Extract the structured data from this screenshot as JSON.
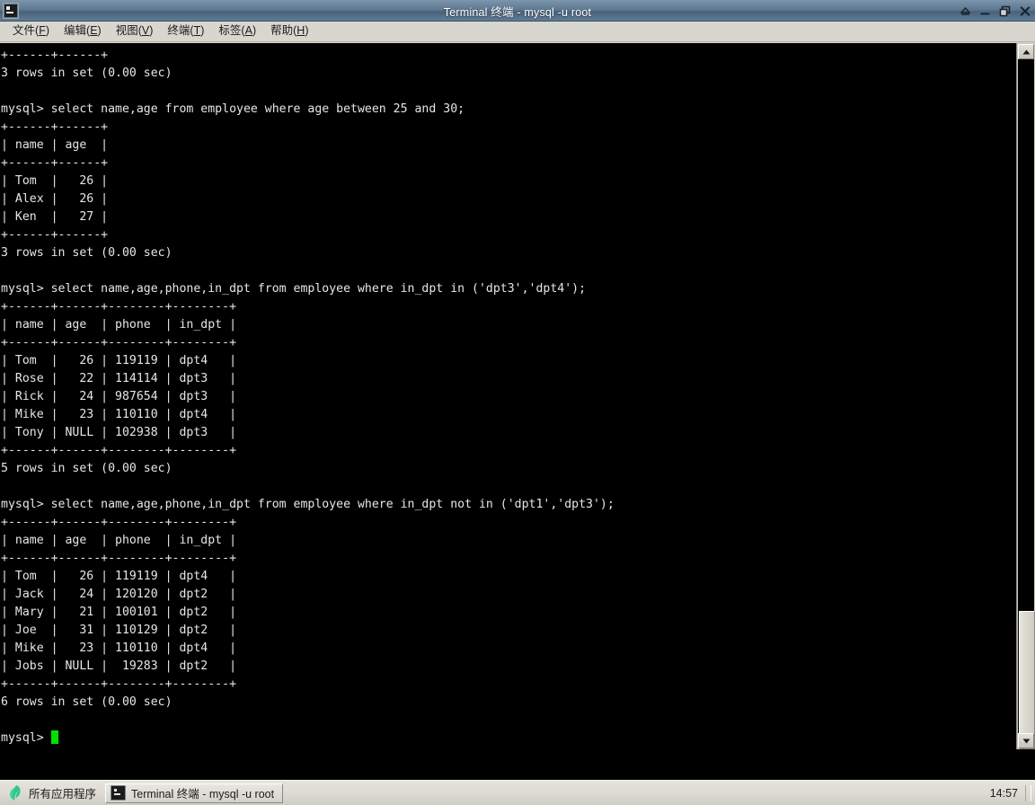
{
  "window": {
    "title": "Terminal 终端 - mysql -u root",
    "icon": "terminal-icon",
    "buttons": {
      "shade": "shade-window-button",
      "minimize": "minimize-window-button",
      "maximize": "maximize-window-button",
      "close": "close-window-button"
    }
  },
  "menubar": {
    "items": [
      {
        "label": "文件",
        "mnemonic": "F",
        "name": "menu-file"
      },
      {
        "label": "编辑",
        "mnemonic": "E",
        "name": "menu-edit"
      },
      {
        "label": "视图",
        "mnemonic": "V",
        "name": "menu-view"
      },
      {
        "label": "终端",
        "mnemonic": "T",
        "name": "menu-terminal"
      },
      {
        "label": "标签",
        "mnemonic": "A",
        "name": "menu-tabs"
      },
      {
        "label": "帮助",
        "mnemonic": "H",
        "name": "menu-help"
      }
    ]
  },
  "terminal": {
    "prompt": "mysql> ",
    "foreground_color": "#e6e6e6",
    "background_color": "#000000",
    "cursor_color": "#00e000",
    "lines": [
      "+------+------+",
      "3 rows in set (0.00 sec)",
      "",
      "mysql> select name,age from employee where age between 25 and 30;",
      "+------+------+",
      "| name | age  |",
      "+------+------+",
      "| Tom  |   26 |",
      "| Alex |   26 |",
      "| Ken  |   27 |",
      "+------+------+",
      "3 rows in set (0.00 sec)",
      "",
      "mysql> select name,age,phone,in_dpt from employee where in_dpt in ('dpt3','dpt4');",
      "+------+------+--------+--------+",
      "| name | age  | phone  | in_dpt |",
      "+------+------+--------+--------+",
      "| Tom  |   26 | 119119 | dpt4   |",
      "| Rose |   22 | 114114 | dpt3   |",
      "| Rick |   24 | 987654 | dpt3   |",
      "| Mike |   23 | 110110 | dpt4   |",
      "| Tony | NULL | 102938 | dpt3   |",
      "+------+------+--------+--------+",
      "5 rows in set (0.00 sec)",
      "",
      "mysql> select name,age,phone,in_dpt from employee where in_dpt not in ('dpt1','dpt3');",
      "+------+------+--------+--------+",
      "| name | age  | phone  | in_dpt |",
      "+------+------+--------+--------+",
      "| Tom  |   26 | 119119 | dpt4   |",
      "| Jack |   24 | 120120 | dpt2   |",
      "| Mary |   21 | 100101 | dpt2   |",
      "| Joe  |   31 | 110129 | dpt2   |",
      "| Mike |   23 | 110110 | dpt4   |",
      "| Jobs | NULL |  19283 | dpt2   |",
      "+------+------+--------+--------+",
      "6 rows in set (0.00 sec)",
      ""
    ],
    "queries": [
      {
        "sql": "select name,age from employee where age between 25 and 30;",
        "columns": [
          "name",
          "age"
        ],
        "rows": [
          [
            "Tom",
            "26"
          ],
          [
            "Alex",
            "26"
          ],
          [
            "Ken",
            "27"
          ]
        ],
        "result_status": "3 rows in set (0.00 sec)"
      },
      {
        "sql": "select name,age,phone,in_dpt from employee where in_dpt in ('dpt3','dpt4');",
        "columns": [
          "name",
          "age",
          "phone",
          "in_dpt"
        ],
        "rows": [
          [
            "Tom",
            "26",
            "119119",
            "dpt4"
          ],
          [
            "Rose",
            "22",
            "114114",
            "dpt3"
          ],
          [
            "Rick",
            "24",
            "987654",
            "dpt3"
          ],
          [
            "Mike",
            "23",
            "110110",
            "dpt4"
          ],
          [
            "Tony",
            "NULL",
            "102938",
            "dpt3"
          ]
        ],
        "result_status": "5 rows in set (0.00 sec)"
      },
      {
        "sql": "select name,age,phone,in_dpt from employee where in_dpt not in ('dpt1','dpt3');",
        "columns": [
          "name",
          "age",
          "phone",
          "in_dpt"
        ],
        "rows": [
          [
            "Tom",
            "26",
            "119119",
            "dpt4"
          ],
          [
            "Jack",
            "24",
            "120120",
            "dpt2"
          ],
          [
            "Mary",
            "21",
            "100101",
            "dpt2"
          ],
          [
            "Joe",
            "31",
            "110129",
            "dpt2"
          ],
          [
            "Mike",
            "23",
            "110110",
            "dpt4"
          ],
          [
            "Jobs",
            "NULL",
            "19283",
            "dpt2"
          ]
        ],
        "result_status": "6 rows in set (0.00 sec)"
      }
    ]
  },
  "scrollbar": {
    "up_arrow": "scroll-up-arrow",
    "down_arrow": "scroll-down-arrow",
    "thumb": "scrollbar-thumb"
  },
  "taskbar": {
    "apps_button_label": "所有应用程序",
    "apps_icon": "leaf-logo-icon",
    "task_button_label": "Terminal 终端 - mysql -u root",
    "task_icon": "terminal-icon",
    "clock": "14:57"
  }
}
